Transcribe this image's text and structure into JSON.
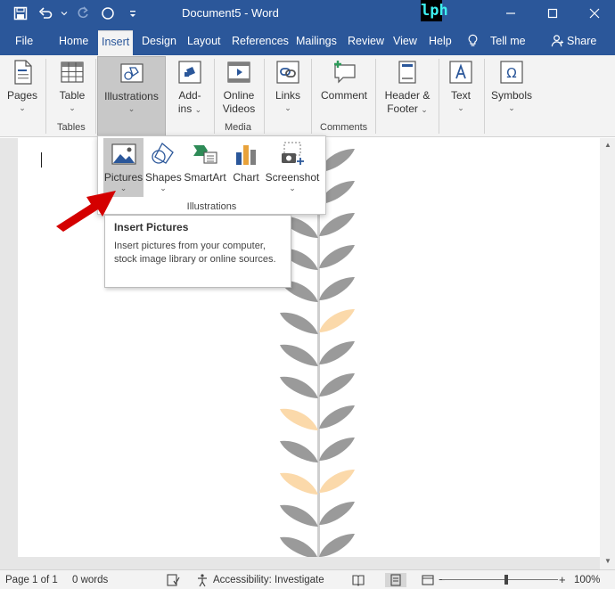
{
  "titlebar": {
    "title": "Document5 - Word",
    "logo_text": "lph",
    "quick_access": [
      "save-icon",
      "undo-icon",
      "undo-dropdown-icon",
      "redo-icon",
      "circle-icon",
      "customize-qat-icon"
    ],
    "window_controls": [
      "minimize-icon",
      "maximize-icon",
      "close-icon"
    ]
  },
  "tabs": {
    "items": [
      "File",
      "Home",
      "Insert",
      "Design",
      "Layout",
      "References",
      "Mailings",
      "Review",
      "View",
      "Help"
    ],
    "active": "Insert",
    "tell_me": "Tell me",
    "share": "Share"
  },
  "ribbon": {
    "pages": {
      "label": "Pages",
      "chevron": "⌄"
    },
    "table": {
      "label": "Table",
      "chevron": "⌄",
      "group": "Tables"
    },
    "illustrations": {
      "label": "Illustrations",
      "chevron": "⌄"
    },
    "addins": {
      "line1": "Add-",
      "line2": "ins",
      "chevron": "⌄"
    },
    "online_videos": {
      "line1": "Online",
      "line2": "Videos",
      "group": "Media"
    },
    "links": {
      "label": "Links",
      "chevron": "⌄"
    },
    "comment": {
      "label": "Comment",
      "group": "Comments"
    },
    "header_footer": {
      "line1": "Header &",
      "line2": "Footer",
      "chevron": "⌄"
    },
    "text": {
      "label": "Text",
      "chevron": "⌄"
    },
    "symbols": {
      "label": "Symbols",
      "chevron": "⌄"
    }
  },
  "dropdown": {
    "items": [
      {
        "label": "Pictures",
        "chevron": "⌄"
      },
      {
        "label": "Shapes",
        "chevron": "⌄"
      },
      {
        "label": "SmartArt"
      },
      {
        "label": "Chart"
      },
      {
        "label": "Screenshot",
        "chevron": "⌄"
      }
    ],
    "group_label": "Illustrations"
  },
  "tooltip": {
    "title": "Insert Pictures",
    "body": "Insert pictures from your computer, stock image library or online sources."
  },
  "statusbar": {
    "page": "Page 1 of 1",
    "words": "0 words",
    "accessibility": "Accessibility: Investigate",
    "zoom_minus": "−",
    "zoom_plus": "+",
    "zoom": "100%",
    "zoom_level_percent": 100
  },
  "colors": {
    "title_bar": "#2b579a",
    "ribbon": "#f3f3f3",
    "arrow": "#d40000",
    "leaf_gray": "#9a9a9a",
    "leaf_peach": "#fbd9aa"
  }
}
